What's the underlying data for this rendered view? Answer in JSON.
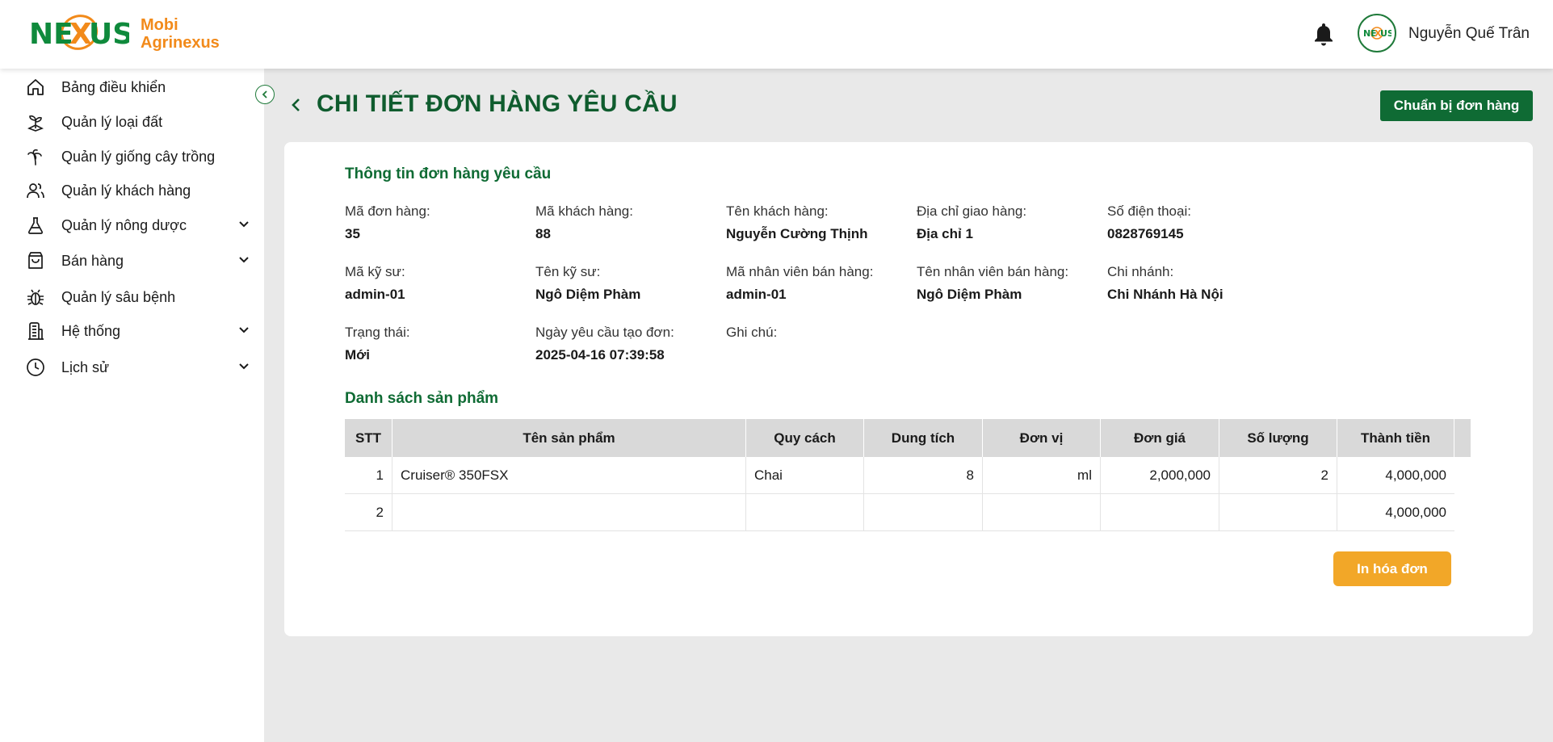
{
  "brand": {
    "name_line1": "Mobi",
    "name_line2": "Agrinexus",
    "logo_text": "NEXUS"
  },
  "header": {
    "user_name": "Nguyễn Quế Trân"
  },
  "sidebar": {
    "items": [
      {
        "label": "Bảng điều khiển",
        "icon": "home-icon"
      },
      {
        "label": "Quản lý loại đất",
        "icon": "soil-icon"
      },
      {
        "label": "Quản lý giống cây trồng",
        "icon": "palm-tree-icon"
      },
      {
        "label": "Quản lý khách hàng",
        "icon": "users-icon"
      },
      {
        "label": "Quản lý nông dược",
        "icon": "flask-icon",
        "expandable": true
      },
      {
        "label": "Bán hàng",
        "icon": "shopping-bag-icon",
        "expandable": true
      },
      {
        "label": "Quản lý sâu bệnh",
        "icon": "bug-icon"
      },
      {
        "label": "Hệ thống",
        "icon": "building-icon",
        "expandable": true
      },
      {
        "label": "Lịch sử",
        "icon": "clock-icon",
        "expandable": true
      }
    ]
  },
  "page": {
    "title": "CHI TIẾT ĐƠN HÀNG YÊU CẦU",
    "prepare_button": "Chuẩn bị đơn hàng",
    "print_button": "In hóa đơn"
  },
  "order_info": {
    "section_title": "Thông tin đơn hàng yêu cầu",
    "fields": [
      {
        "label": "Mã đơn hàng:",
        "value": "35"
      },
      {
        "label": "Mã khách hàng:",
        "value": "88"
      },
      {
        "label": "Tên khách hàng:",
        "value": "Nguyễn Cường Thịnh"
      },
      {
        "label": "Địa chỉ giao hàng:",
        "value": "Địa chỉ 1"
      },
      {
        "label": "Số điện thoại:",
        "value": "0828769145"
      },
      {
        "label": "Mã kỹ sư:",
        "value": "admin-01"
      },
      {
        "label": "Tên kỹ sư:",
        "value": "Ngô Diệm Phàm"
      },
      {
        "label": "Mã nhân viên bán hàng:",
        "value": "admin-01"
      },
      {
        "label": "Tên nhân viên bán hàng:",
        "value": "Ngô Diệm Phàm"
      },
      {
        "label": "Chi nhánh:",
        "value": "Chi Nhánh Hà Nội"
      },
      {
        "label": "Trạng thái:",
        "value": "Mới"
      },
      {
        "label": "Ngày yêu cầu tạo đơn:",
        "value": "2025-04-16 07:39:58"
      },
      {
        "label": "Ghi chú:",
        "value": ""
      }
    ]
  },
  "products": {
    "section_title": "Danh sách sản phẩm",
    "columns": [
      "STT",
      "Tên sản phẩm",
      "Quy cách",
      "Dung tích",
      "Đơn vị",
      "Đơn giá",
      "Số lượng",
      "Thành tiền"
    ],
    "rows": [
      [
        "1",
        "Cruiser® 350FSX",
        "Chai",
        "8",
        "ml",
        "2,000,000",
        "2",
        "4,000,000"
      ],
      [
        "2",
        "",
        "",
        "",
        "",
        "",
        "",
        "4,000,000"
      ]
    ]
  },
  "colors": {
    "primary_green": "#0f6b34",
    "accent_orange": "#f2a728",
    "brand_orange": "#f28a1a"
  }
}
